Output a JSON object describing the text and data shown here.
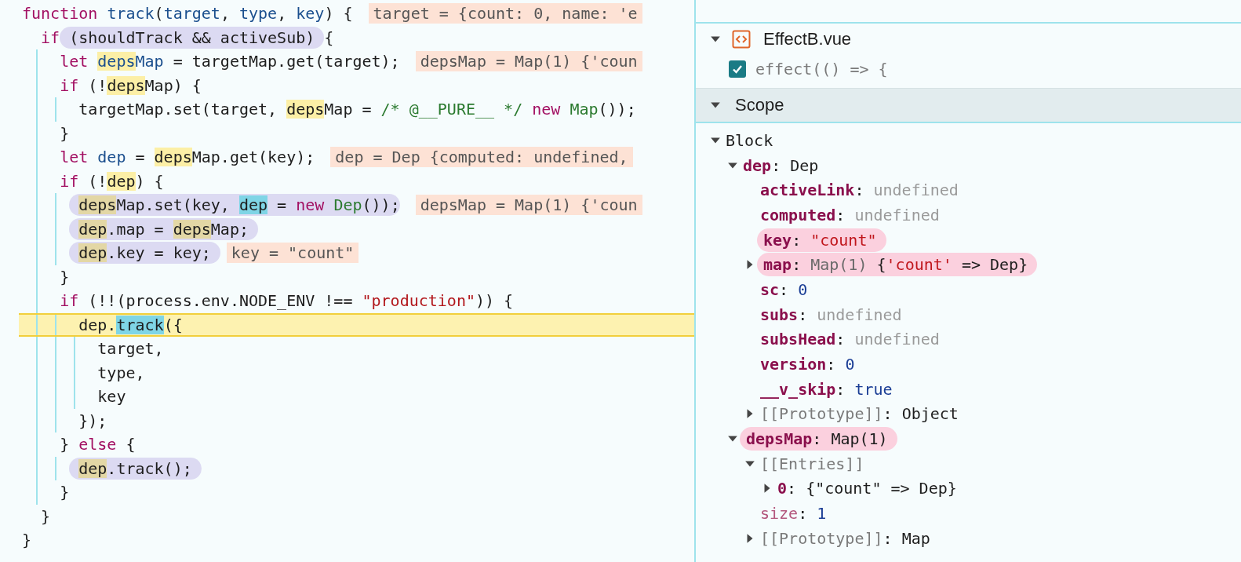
{
  "editor": {
    "lines": [
      {
        "current": false,
        "inline_value": "target = {count: 0, name: 'e",
        "tokens": [
          {
            "kind": "kw",
            "text": "function "
          },
          {
            "kind": "def",
            "text": "track"
          },
          {
            "kind": "plain",
            "text": "("
          },
          {
            "kind": "def",
            "text": "target"
          },
          {
            "kind": "plain",
            "text": ", "
          },
          {
            "kind": "def",
            "text": "type"
          },
          {
            "kind": "plain",
            "text": ", "
          },
          {
            "kind": "def",
            "text": "key"
          },
          {
            "kind": "plain",
            "text": ") {"
          }
        ]
      },
      {
        "current": false,
        "tokens": [
          {
            "kind": "kw",
            "text": "  if "
          },
          {
            "kind": "circled",
            "tokens": [
              {
                "kind": "plain",
                "text": "(shouldTrack && activeSub)"
              }
            ]
          },
          {
            "kind": "plain",
            "text": " {"
          }
        ]
      },
      {
        "current": false,
        "inline_value": "depsMap = Map(1) {'coun",
        "tokens": [
          {
            "kind": "kw",
            "text": "    let "
          },
          {
            "kind": "def-match",
            "text": "deps"
          },
          {
            "kind": "def",
            "text": "Map"
          },
          {
            "kind": "plain",
            "text": " = targetMap.get(target);"
          }
        ]
      },
      {
        "current": false,
        "tokens": [
          {
            "kind": "kw",
            "text": "    if"
          },
          {
            "kind": "plain",
            "text": " (!"
          },
          {
            "kind": "match",
            "text": "deps"
          },
          {
            "kind": "plain",
            "text": "Map) {"
          }
        ]
      },
      {
        "current": false,
        "tokens": [
          {
            "kind": "plain",
            "text": "      targetMap.set(target, "
          },
          {
            "kind": "match",
            "text": "deps"
          },
          {
            "kind": "plain",
            "text": "Map = "
          },
          {
            "kind": "com",
            "text": "/* @__PURE__ */ "
          },
          {
            "kind": "kw",
            "text": "new "
          },
          {
            "kind": "cls",
            "text": "Map"
          },
          {
            "kind": "plain",
            "text": "());"
          }
        ]
      },
      {
        "current": false,
        "tokens": [
          {
            "kind": "plain",
            "text": "    }"
          }
        ]
      },
      {
        "current": false,
        "inline_value": "dep = Dep {computed: undefined,",
        "tokens": [
          {
            "kind": "kw",
            "text": "    let "
          },
          {
            "kind": "def",
            "text": "dep"
          },
          {
            "kind": "plain",
            "text": " = "
          },
          {
            "kind": "match",
            "text": "deps"
          },
          {
            "kind": "plain",
            "text": "Map.get(key);"
          }
        ]
      },
      {
        "current": false,
        "tokens": [
          {
            "kind": "kw",
            "text": "    if"
          },
          {
            "kind": "plain",
            "text": " (!"
          },
          {
            "kind": "match",
            "text": "dep"
          },
          {
            "kind": "plain",
            "text": ") {"
          }
        ]
      },
      {
        "current": false,
        "inline_value": "depsMap = Map(1) {'coun",
        "tokens": [
          {
            "kind": "circled",
            "tokens": [
              {
                "kind": "match",
                "text": "      deps"
              },
              {
                "kind": "plain",
                "text": "Map.set(key, "
              },
              {
                "kind": "selection",
                "text": "dep"
              },
              {
                "kind": "plain",
                "text": " = "
              },
              {
                "kind": "kw",
                "text": "new "
              },
              {
                "kind": "cls",
                "text": "Dep"
              },
              {
                "kind": "plain",
                "text": "())"
              }
            ]
          },
          {
            "kind": "plain",
            "text": ";"
          }
        ]
      },
      {
        "current": false,
        "tokens": [
          {
            "kind": "circled",
            "tokens": [
              {
                "kind": "match",
                "text": "      dep"
              },
              {
                "kind": "plain",
                "text": ".map = "
              },
              {
                "kind": "match",
                "text": "deps"
              },
              {
                "kind": "plain",
                "text": "Map;"
              }
            ]
          }
        ]
      },
      {
        "current": false,
        "inline_value": "key = \"count\"",
        "tokens": [
          {
            "kind": "circled",
            "tokens": [
              {
                "kind": "match",
                "text": "      dep"
              },
              {
                "kind": "plain",
                "text": ".key = key;"
              }
            ]
          }
        ]
      },
      {
        "current": false,
        "tokens": [
          {
            "kind": "plain",
            "text": "    }"
          }
        ]
      },
      {
        "current": false,
        "tokens": [
          {
            "kind": "kw",
            "text": "    if"
          },
          {
            "kind": "plain",
            "text": " (!!(process.env.NODE_ENV !== "
          },
          {
            "kind": "str",
            "text": "\"production\""
          },
          {
            "kind": "plain",
            "text": ")) {"
          }
        ]
      },
      {
        "current": true,
        "tokens": [
          {
            "kind": "plain",
            "text": "      dep."
          },
          {
            "kind": "selection",
            "text": "track"
          },
          {
            "kind": "plain",
            "text": "({"
          }
        ]
      },
      {
        "current": false,
        "tokens": [
          {
            "kind": "plain",
            "text": "        target,"
          }
        ]
      },
      {
        "current": false,
        "tokens": [
          {
            "kind": "plain",
            "text": "        type,"
          }
        ]
      },
      {
        "current": false,
        "tokens": [
          {
            "kind": "plain",
            "text": "        key"
          }
        ]
      },
      {
        "current": false,
        "tokens": [
          {
            "kind": "plain",
            "text": "      });"
          }
        ]
      },
      {
        "current": false,
        "tokens": [
          {
            "kind": "plain",
            "text": "    } "
          },
          {
            "kind": "kw",
            "text": "else"
          },
          {
            "kind": "plain",
            "text": " {"
          }
        ]
      },
      {
        "current": false,
        "tokens": [
          {
            "kind": "circled",
            "tokens": [
              {
                "kind": "match",
                "text": "      dep"
              },
              {
                "kind": "plain",
                "text": ".track();"
              }
            ]
          }
        ]
      },
      {
        "current": false,
        "tokens": [
          {
            "kind": "plain",
            "text": "    }"
          }
        ]
      },
      {
        "current": false,
        "tokens": [
          {
            "kind": "plain",
            "text": "  }"
          }
        ]
      },
      {
        "current": false,
        "tokens": [
          {
            "kind": "plain",
            "text": "}"
          }
        ]
      }
    ]
  },
  "debugger": {
    "file": {
      "name": "EffectB.vue",
      "expanded": true
    },
    "breakpoint": {
      "label": "effect(() => {",
      "checked": true
    },
    "scope_header": {
      "label": "Scope",
      "expanded": true
    },
    "scope": [
      {
        "key": "Block",
        "kind": "scope",
        "circled": false,
        "expanded": true,
        "children": [
          {
            "key": "dep",
            "kind": "own",
            "circled": false,
            "expanded": true,
            "value": [
              {
                "kind": "punct",
                "text": ":"
              },
              {
                "kind": "object",
                "text": "Dep"
              }
            ],
            "children": [
              {
                "key": "activeLink",
                "kind": "own",
                "circled": false,
                "value": [
                  {
                    "kind": "punct",
                    "text": ":"
                  },
                  {
                    "kind": "undefined",
                    "text": "undefined"
                  }
                ]
              },
              {
                "key": "computed",
                "kind": "own",
                "circled": false,
                "value": [
                  {
                    "kind": "punct",
                    "text": ":"
                  },
                  {
                    "kind": "undefined",
                    "text": "undefined"
                  }
                ]
              },
              {
                "key": "key",
                "kind": "own",
                "circled": true,
                "value": [
                  {
                    "kind": "punct",
                    "text": ":"
                  },
                  {
                    "kind": "string",
                    "text": "\"count\""
                  }
                ]
              },
              {
                "key": "map",
                "kind": "own",
                "circled": true,
                "expanded": false,
                "value": [
                  {
                    "kind": "punct",
                    "text": ":"
                  },
                  {
                    "kind": "preview",
                    "text": "Map(1) "
                  },
                  {
                    "kind": "object",
                    "text": "{"
                  },
                  {
                    "kind": "string",
                    "text": "'count'"
                  },
                  {
                    "kind": "object",
                    "text": " => Dep}"
                  }
                ]
              },
              {
                "key": "sc",
                "kind": "own",
                "circled": false,
                "value": [
                  {
                    "kind": "punct",
                    "text": ":"
                  },
                  {
                    "kind": "number",
                    "text": "0"
                  }
                ]
              },
              {
                "key": "subs",
                "kind": "own",
                "circled": false,
                "value": [
                  {
                    "kind": "punct",
                    "text": ":"
                  },
                  {
                    "kind": "undefined",
                    "text": "undefined"
                  }
                ]
              },
              {
                "key": "subsHead",
                "kind": "own",
                "circled": false,
                "value": [
                  {
                    "kind": "punct",
                    "text": ":"
                  },
                  {
                    "kind": "undefined",
                    "text": "undefined"
                  }
                ]
              },
              {
                "key": "version",
                "kind": "own",
                "circled": false,
                "value": [
                  {
                    "kind": "punct",
                    "text": ":"
                  },
                  {
                    "kind": "number",
                    "text": "0"
                  }
                ]
              },
              {
                "key": "__v_skip",
                "kind": "own",
                "circled": false,
                "value": [
                  {
                    "kind": "punct",
                    "text": ":"
                  },
                  {
                    "kind": "number",
                    "text": "true"
                  }
                ]
              },
              {
                "key": "[[Prototype]]",
                "kind": "internal",
                "circled": false,
                "expanded": false,
                "value": [
                  {
                    "kind": "punct",
                    "text": ":"
                  },
                  {
                    "kind": "object",
                    "text": "Object"
                  }
                ]
              }
            ]
          },
          {
            "key": "depsMap",
            "kind": "own",
            "circled": true,
            "expanded": true,
            "value": [
              {
                "kind": "punct",
                "text": ":"
              },
              {
                "kind": "object",
                "text": "Map(1)"
              }
            ],
            "children": [
              {
                "key": "[[Entries]]",
                "kind": "internal",
                "circled": false,
                "expanded": true,
                "children": [
                  {
                    "key": "0",
                    "kind": "own",
                    "circled": false,
                    "expanded": false,
                    "value": [
                      {
                        "kind": "punct",
                        "text": ":"
                      },
                      {
                        "kind": "object",
                        "text": "{\"count\" => Dep}"
                      }
                    ]
                  }
                ]
              },
              {
                "key": "size",
                "kind": "accessor",
                "circled": false,
                "value": [
                  {
                    "kind": "punct",
                    "text": ":"
                  },
                  {
                    "kind": "number",
                    "text": "1"
                  }
                ]
              },
              {
                "key": "[[Prototype]]",
                "kind": "internal",
                "circled": false,
                "expanded": false,
                "value": [
                  {
                    "kind": "punct",
                    "text": ":"
                  },
                  {
                    "kind": "object",
                    "text": "Map"
                  }
                ]
              }
            ]
          }
        ]
      }
    ]
  }
}
